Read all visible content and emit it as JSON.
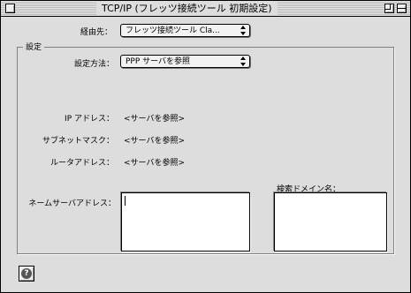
{
  "window": {
    "title": "TCP/IP (フレッツ接続ツール 初期設定)"
  },
  "connection": {
    "label": "経由先：",
    "value": "フレッツ接続ツール Cla..."
  },
  "settings_group": {
    "title": "設定",
    "method_label": "設定方法：",
    "method_value": "PPP サーバを参照",
    "ip_label": "IP アドレス：",
    "ip_value": "<サーバを参照>",
    "subnet_label": "サブネットマスク：",
    "subnet_value": "<サーバを参照>",
    "router_label": "ルータアドレス：",
    "router_value": "<サーバを参照>",
    "nameserver_label": "ネームサーバアドレス：",
    "nameserver_value": "",
    "search_domain_label": "検索ドメイン名："
  },
  "help": {
    "icon": "help-icon",
    "glyph": "?"
  }
}
